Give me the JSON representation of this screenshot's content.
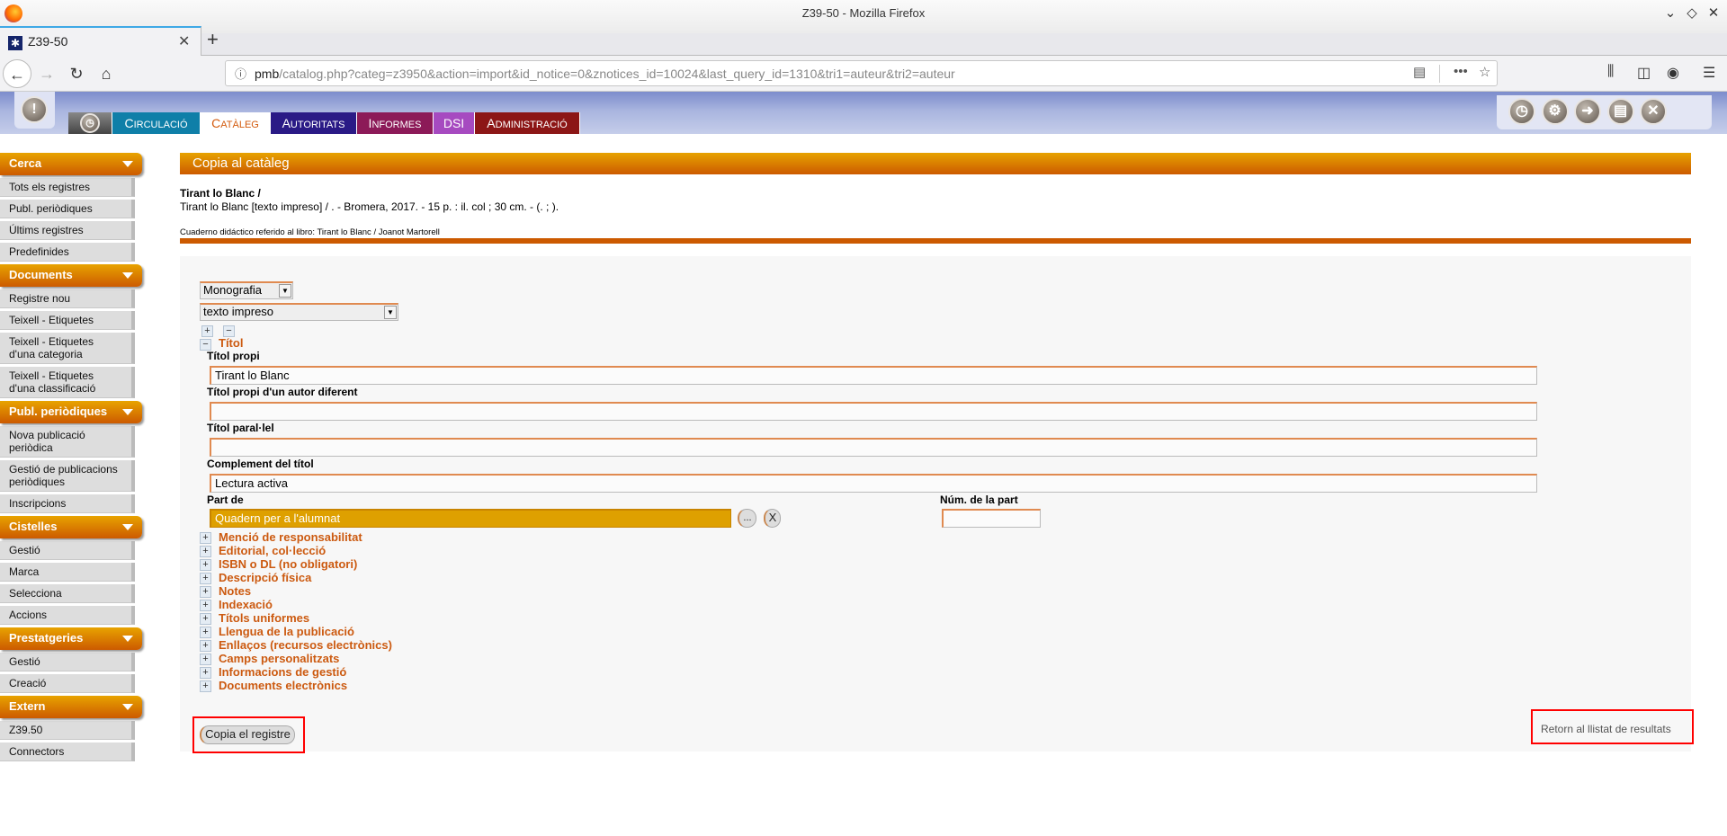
{
  "window": {
    "title": "Z39-50 - Mozilla Firefox"
  },
  "browser": {
    "tab_title": "Z39-50",
    "url_host": "pmb",
    "url_path": "/catalog.php?categ=z3950&action=import&id_notice=0&znotices_id=10024&last_query_id=1310&tri1=auteur&tri2=auteur"
  },
  "menu": {
    "tabs": [
      {
        "first": "C",
        "rest": "IRCULACIÓ",
        "color": "#0f7fa8"
      },
      {
        "first": "C",
        "rest": "ATÀLEG",
        "color": "#ffffff",
        "active": true
      },
      {
        "first": "A",
        "rest": "UTORITATS",
        "color": "#2a1a86"
      },
      {
        "first": "I",
        "rest": "NFORMES",
        "color": "#8c1a58"
      },
      {
        "first": "DSI",
        "rest": "",
        "color": "#a64ac0"
      },
      {
        "first": "A",
        "rest": "DMINISTRACIÓ",
        "color": "#8c1616"
      }
    ],
    "right_icons": [
      "clock-icon",
      "gear-icon",
      "user-login-icon",
      "save-icon",
      "close-icon"
    ]
  },
  "sidebar": [
    {
      "title": "Cerca",
      "items": [
        "Tots els registres",
        "Publ. periòdiques",
        "Últims registres",
        "Predefinides"
      ]
    },
    {
      "title": "Documents",
      "items": [
        "Registre nou",
        "Teixell - Etiquetes",
        "Teixell - Etiquetes d'una categoria",
        "Teixell - Etiquetes d'una classificació"
      ]
    },
    {
      "title": "Publ. periòdiques",
      "items": [
        "Nova publicació periòdica",
        "Gestió de publicacions periòdiques",
        "Inscripcions"
      ]
    },
    {
      "title": "Cistelles",
      "items": [
        "Gestió",
        "Marca",
        "Selecciona",
        "Accions"
      ]
    },
    {
      "title": "Prestatgeries",
      "items": [
        "Gestió",
        "Creació"
      ]
    },
    {
      "title": "Extern",
      "items": [
        "Z39.50",
        "Connectors"
      ]
    }
  ],
  "main": {
    "header": "Copia al catàleg",
    "record_title": "Tirant lo Blanc /",
    "record_isbd": "Tirant lo Blanc [texto impreso] / . - Bromera, 2017. - 15 p. : il. col ; 30 cm. - (. ; ).",
    "record_note": "Cuaderno didáctico referido al libro: Tirant lo Blanc / Joanot Martorell",
    "type_select": "Monografia",
    "support_select": "texto impreso",
    "title_section": "Títol",
    "fields": {
      "titol_propi": {
        "label": "Títol propi",
        "value": "Tirant lo Blanc"
      },
      "titol_autor": {
        "label": "Títol propi d'un autor diferent",
        "value": ""
      },
      "titol_parallel": {
        "label": "Títol paral·lel",
        "value": ""
      },
      "complement": {
        "label": "Complement del títol",
        "value": "Lectura activa"
      },
      "part_de": {
        "label": "Part de",
        "value": "Quadern per a l'alumnat"
      },
      "num_part": {
        "label": "Núm. de la part",
        "value": ""
      }
    },
    "browse_button": "...",
    "clear_button": "X",
    "sections": [
      "Menció de responsabilitat",
      "Editorial, col·lecció",
      "ISBN o DL (no obligatori)",
      "Descripció física",
      "Notes",
      "Indexació",
      "Títols uniformes",
      "Llengua de la publicació",
      "Enllaços (recursos electrònics)",
      "Camps personalitzats",
      "Informacions de gestió",
      "Documents electrònics"
    ],
    "copy_button": "Copia el registre",
    "return_link": "Retorn al llistat de resultats"
  }
}
